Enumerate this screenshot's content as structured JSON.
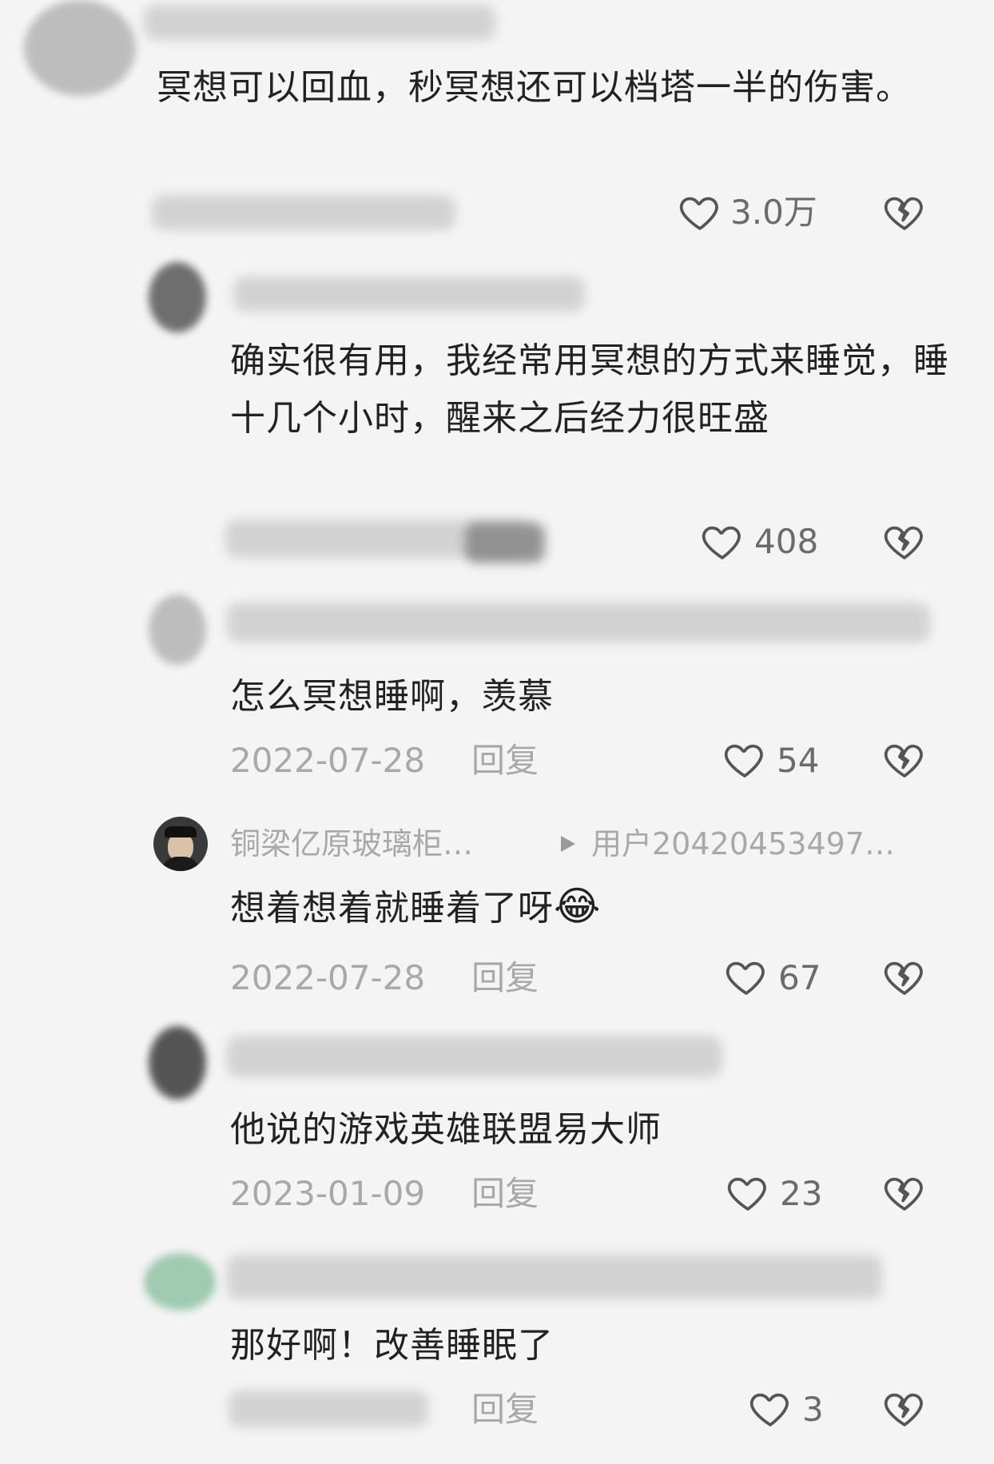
{
  "comments": [
    {
      "text": "冥想可以回血，秒冥想还可以档塔一半的伤害。",
      "likes": "3.0万"
    },
    {
      "text": "确实很有用，我经常用冥想的方式来睡觉，睡十几个小时，醒来之后经力很旺盛",
      "likes": "408"
    },
    {
      "text": "怎么冥想睡啊，羡慕",
      "date": "2022-07-28",
      "reply": "回复",
      "likes": "54"
    },
    {
      "username": "铜梁亿原玻璃柜…",
      "reply_to": "用户20420453497…",
      "text": "想着想着就睡着了呀",
      "emoji": "😂",
      "date": "2022-07-28",
      "reply": "回复",
      "likes": "67"
    },
    {
      "text": "他说的游戏英雄联盟易大师",
      "date": "2023-01-09",
      "reply": "回复",
      "likes": "23"
    },
    {
      "text": "那好啊！改善睡眠了",
      "reply": "回复",
      "likes": "3"
    }
  ],
  "icons": {
    "like": "heart-outline-icon",
    "dislike": "broken-heart-icon",
    "reply_arrow": "play-triangle-icon"
  }
}
